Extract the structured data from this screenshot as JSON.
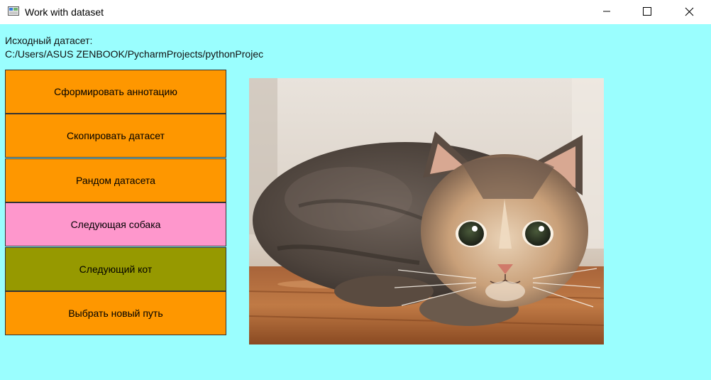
{
  "window": {
    "title": "Work with dataset",
    "controls": {
      "minimize_icon": "minimize-icon",
      "maximize_icon": "maximize-icon",
      "close_icon": "close-icon"
    }
  },
  "source": {
    "label": "Исходный датасет:",
    "path": "C:/Users/ASUS ZENBOOK/PycharmProjects/pythonProjec"
  },
  "buttons": [
    {
      "label": "Сформировать аннотацию",
      "color": "#fe9700"
    },
    {
      "label": "Скопировать датасет",
      "color": "#fe9700"
    },
    {
      "label": "Рандом датасета",
      "color": "#fe9700"
    },
    {
      "label": "Следующая собака",
      "color": "#fe97cc"
    },
    {
      "label": "Следующий кот",
      "color": "#969900"
    },
    {
      "label": "Выбрать новый путь",
      "color": "#fe9700"
    }
  ],
  "image": {
    "subject": "cat-photo"
  },
  "colors": {
    "background": "#9afefe",
    "titlebar": "#ffffff"
  }
}
